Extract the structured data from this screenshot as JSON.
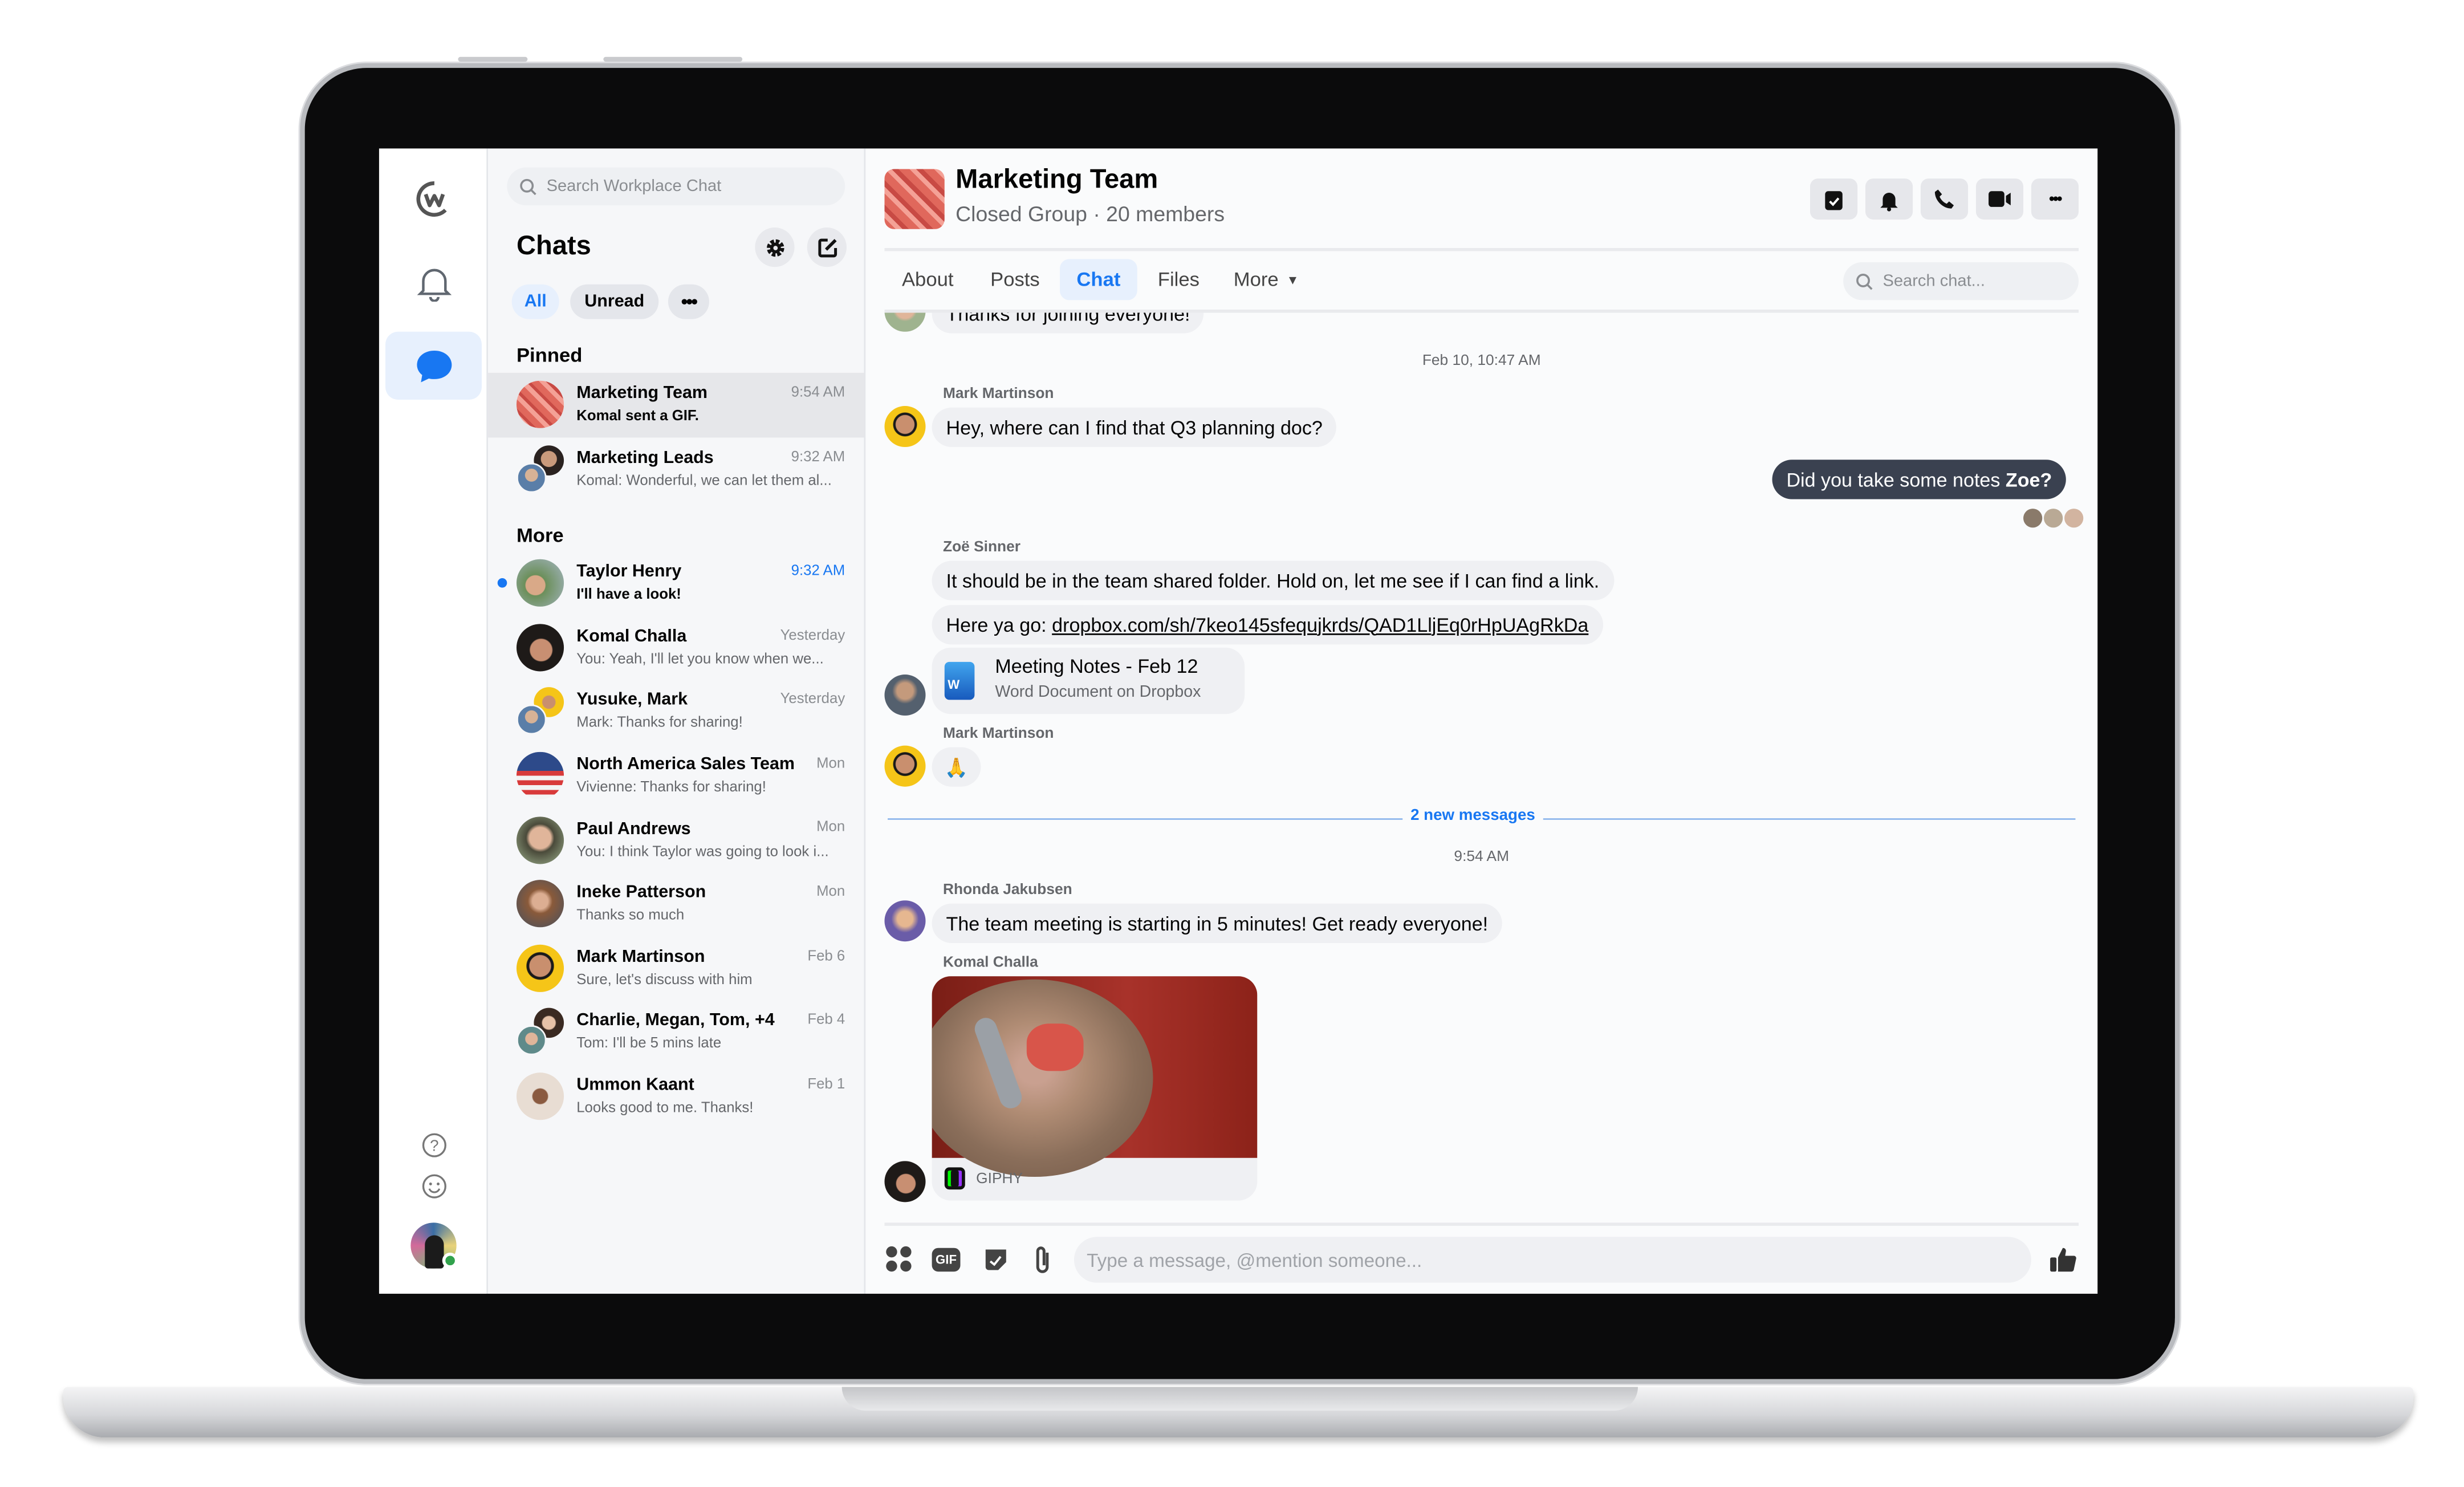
{
  "colors": {
    "accent": "#1877f2",
    "own_bubble": "#3a4150",
    "online": "#31a24c"
  },
  "rail": {
    "icons": [
      "workplace-logo-icon",
      "bell-icon",
      "chat-bubble-icon",
      "help-icon",
      "emoji-icon"
    ],
    "active": "chat-bubble-icon"
  },
  "list": {
    "search_placeholder": "Search Workplace Chat",
    "title": "Chats",
    "filters": {
      "all": "All",
      "unread": "Unread"
    },
    "pinned_label": "Pinned",
    "more_label": "More",
    "pinned": [
      {
        "name": "Marketing Team",
        "preview": "Komal sent a GIF.",
        "time": "9:54 AM",
        "selected": true
      },
      {
        "name": "Marketing Leads",
        "preview": "Komal: Wonderful, we can let them al...",
        "time": "9:32 AM"
      }
    ],
    "more": [
      {
        "name": "Taylor Henry",
        "preview": "I'll have a look!",
        "time": "9:32 AM",
        "unread": true
      },
      {
        "name": "Komal Challa",
        "preview": "You: Yeah, I'll let you know when we...",
        "time": "Yesterday"
      },
      {
        "name": "Yusuke, Mark",
        "preview": "Mark: Thanks for sharing!",
        "time": "Yesterday"
      },
      {
        "name": "North America Sales Team",
        "preview": "Vivienne: Thanks for sharing!",
        "time": "Mon"
      },
      {
        "name": "Paul Andrews",
        "preview": "You: I think Taylor was going to look i...",
        "time": "Mon"
      },
      {
        "name": "Ineke Patterson",
        "preview": "Thanks so much",
        "time": "Mon"
      },
      {
        "name": "Mark Martinson",
        "preview": "Sure, let's discuss with him",
        "time": "Feb 6"
      },
      {
        "name": "Charlie, Megan, Tom, +4",
        "preview": "Tom: I'll be 5 mins late",
        "time": "Feb 4"
      },
      {
        "name": "Ummon Kaant",
        "preview": "Looks good to me. Thanks!",
        "time": "Feb 1"
      }
    ]
  },
  "header": {
    "title": "Marketing Team",
    "subtitle": "Closed Group · 20 members",
    "actions": [
      "tasks-icon",
      "bell-icon",
      "phone-icon",
      "video-icon",
      "more-icon"
    ],
    "tabs": [
      "About",
      "Posts",
      "Chat",
      "Files",
      "More"
    ],
    "active_tab": "Chat",
    "search_placeholder": "Search chat..."
  },
  "messages": {
    "prev_text": "Thanks for joining everyone!",
    "ts1": "Feb 10, 10:47 AM",
    "m1_sender": "Mark Martinson",
    "m1_text": "Hey, where can I find that Q3 planning doc?",
    "own_text": "Did you take some notes ",
    "own_mention": "Zoe?",
    "m2_sender": "Zoë Sinner",
    "m2_text1": "It should be in the team shared folder. Hold on, let me see if I can find a link.",
    "m2_text2_prefix": "Here ya go: ",
    "m2_link": "dropbox.com/sh/7keo145sfequjkrds/QAD1LljEq0rHpUAgRkDa",
    "file_title": "Meeting Notes - Feb 12",
    "file_sub": "Word Document on Dropbox",
    "file_badge": "W",
    "m3_sender": "Mark Martinson",
    "m3_text": "🙏",
    "new_divider": "2 new messages",
    "ts2": "9:54 AM",
    "m4_sender": "Rhonda Jakubsen",
    "m4_text": "The team meeting is starting in 5 minutes! Get ready everyone!",
    "m5_sender": "Komal Challa",
    "gif_source": "GIPHY"
  },
  "composer": {
    "placeholder": "Type a message, @mention someone...",
    "gif_label": "GIF"
  }
}
